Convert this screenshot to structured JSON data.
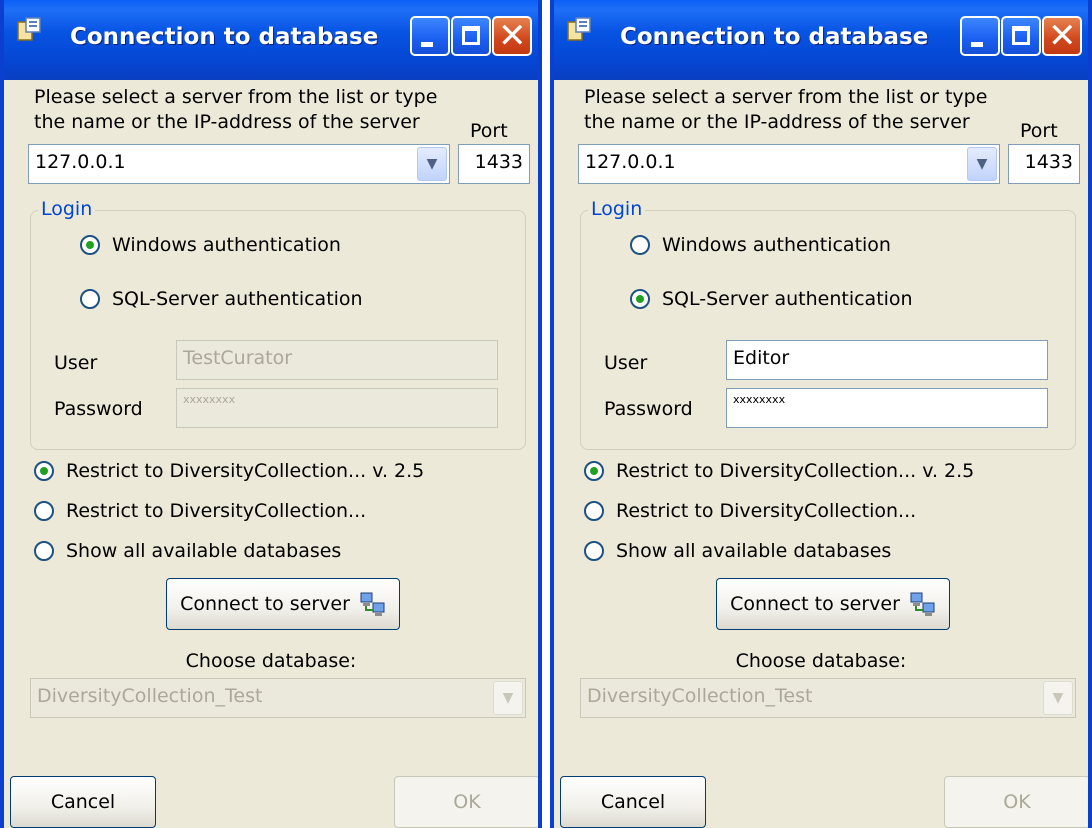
{
  "windows": [
    {
      "title": "Connection to database",
      "prompt_line1": "Please select a server from the list or type",
      "prompt_line2": "the name or the IP-address of the server",
      "port_label": "Port",
      "server": "127.0.0.1",
      "port": "1433",
      "login_legend": "Login",
      "auth_windows": "Windows authentication",
      "auth_sql": "SQL-Server authentication",
      "selected_auth": "windows",
      "user_label": "User",
      "user_value": "TestCurator",
      "password_label": "Password",
      "password_value": "xxxxxxxx",
      "credentials_enabled": false,
      "restrict_version": "Restrict to DiversityCollection... v. 2.5",
      "restrict": "Restrict to DiversityCollection...",
      "show_all": "Show all available databases",
      "selected_scope": "restrict_version",
      "connect_button": "Connect to server",
      "choose_db_label": "Choose database:",
      "database": "DiversityCollection_Test",
      "cancel": "Cancel",
      "ok": "OK"
    },
    {
      "title": "Connection to database",
      "prompt_line1": "Please select a server from the list or type",
      "prompt_line2": "the name or the IP-address of the server",
      "port_label": "Port",
      "server": "127.0.0.1",
      "port": "1433",
      "login_legend": "Login",
      "auth_windows": "Windows authentication",
      "auth_sql": "SQL-Server authentication",
      "selected_auth": "sql",
      "user_label": "User",
      "user_value": "Editor",
      "password_label": "Password",
      "password_value": "xxxxxxxx",
      "credentials_enabled": true,
      "restrict_version": "Restrict to DiversityCollection... v. 2.5",
      "restrict": "Restrict to DiversityCollection...",
      "show_all": "Show all available databases",
      "selected_scope": "restrict_version",
      "connect_button": "Connect to server",
      "choose_db_label": "Choose database:",
      "database": "DiversityCollection_Test",
      "cancel": "Cancel",
      "ok": "OK"
    }
  ],
  "icons": {
    "app": "app-icon",
    "minimize": "minimize-icon",
    "maximize": "maximize-icon",
    "close": "close-icon",
    "connect": "network-computers-icon",
    "dropdown": "chevron-down-icon"
  },
  "colors": {
    "title_bar": "#0754e3",
    "window_bg": "#ece9d8",
    "legend_text": "#0046d5",
    "radio_dot": "#21a121",
    "close_button": "#d1461c"
  }
}
